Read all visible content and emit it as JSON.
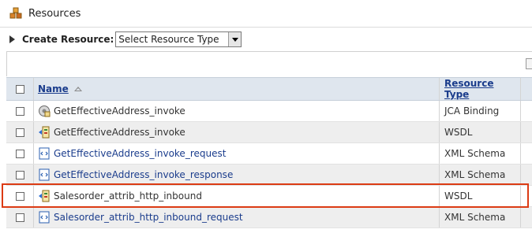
{
  "header": {
    "title": "Resources"
  },
  "create": {
    "label": "Create Resource:",
    "select_value": "Select Resource Type"
  },
  "table": {
    "columns": {
      "name": "Name",
      "type": "Resource Type"
    },
    "rows": [
      {
        "name": "GetEffectiveAddress_invoke",
        "type": "JCA Binding",
        "icon": "jca-binding-icon",
        "link": false
      },
      {
        "name": "GetEffectiveAddress_invoke",
        "type": "WSDL",
        "icon": "wsdl-icon",
        "link": false
      },
      {
        "name": "GetEffectiveAddress_invoke_request",
        "type": "XML Schema",
        "icon": "xml-schema-icon",
        "link": true
      },
      {
        "name": "GetEffectiveAddress_invoke_response",
        "type": "XML Schema",
        "icon": "xml-schema-icon",
        "link": true
      },
      {
        "name": "Salesorder_attrib_http_inbound",
        "type": "WSDL",
        "icon": "wsdl-icon",
        "link": false
      },
      {
        "name": "Salesorder_attrib_http_inbound_request",
        "type": "XML Schema",
        "icon": "xml-schema-icon",
        "link": true
      }
    ]
  },
  "colors": {
    "highlight": "#dc3b14",
    "link": "#1a3c8c",
    "header_bg": "#dfe6ee"
  }
}
